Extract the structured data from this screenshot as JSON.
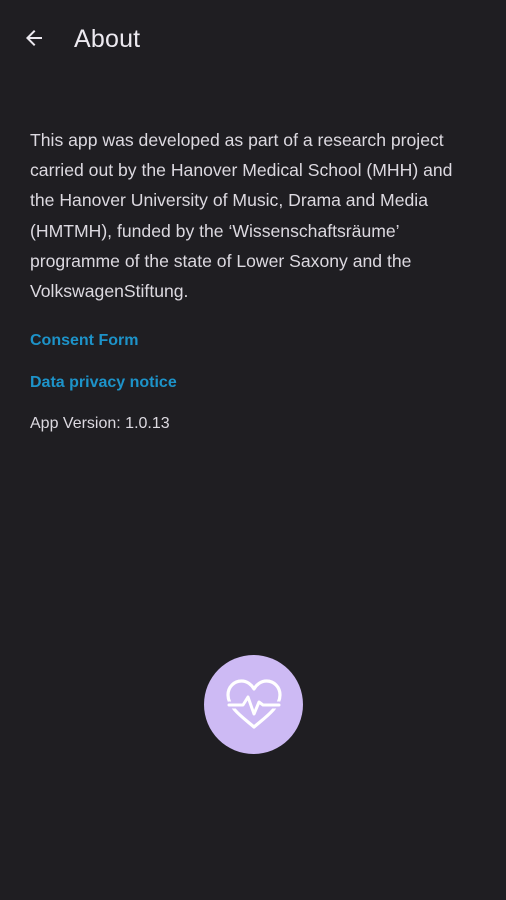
{
  "header": {
    "title": "About",
    "back_icon": "arrow-back-icon"
  },
  "content": {
    "description": "This app was developed as part of a research project carried out by the Hanover Medical School (MHH) and the Hanover University of Music, Drama and Media (HMTMH), funded by the ‘Wissenschaftsräume’ programme of the state of Lower Saxony and the VolkswagenStiftung.",
    "consent_link": "Consent Form",
    "privacy_link": "Data privacy notice",
    "version": "App Version: 1.0.13"
  },
  "logo": {
    "icon": "heart-pulse-icon",
    "background_color": "#cdbaf4"
  },
  "colors": {
    "background": "#1f1e22",
    "link": "#1d93c9",
    "text": "#dcd9e0"
  }
}
